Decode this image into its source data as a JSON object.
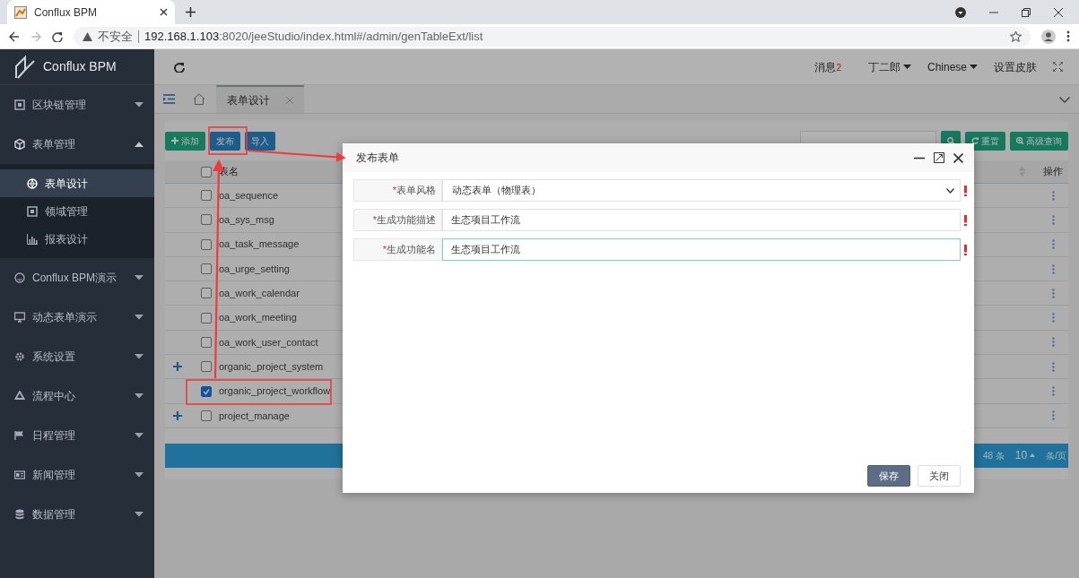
{
  "browser": {
    "tab_title": "Conflux BPM",
    "insecure_label": "不安全",
    "url_host": "192.168.1.103",
    "url_path": ":8020/jeeStudio/index.html#/admin/genTableExt/list"
  },
  "app": {
    "logo_text": "Conflux BPM"
  },
  "sidebar": {
    "items": [
      {
        "label": "区块链管理",
        "expanded": false
      },
      {
        "label": "表单管理",
        "expanded": true,
        "children": [
          {
            "label": "表单设计",
            "selected": true
          },
          {
            "label": "领域管理",
            "selected": false
          },
          {
            "label": "报表设计",
            "selected": false
          }
        ]
      },
      {
        "label": "Conflux BPM演示",
        "expanded": false
      },
      {
        "label": "动态表单演示",
        "expanded": false
      },
      {
        "label": "系统设置",
        "expanded": false
      },
      {
        "label": "流程中心",
        "expanded": false
      },
      {
        "label": "日程管理",
        "expanded": false
      },
      {
        "label": "新闻管理",
        "expanded": false
      },
      {
        "label": "数据管理",
        "expanded": false
      }
    ]
  },
  "header": {
    "messages_label": "消息",
    "messages_count": "2",
    "user": "丁二郎",
    "language": "Chinese",
    "skin": "设置皮肤"
  },
  "tabs": [
    {
      "label": "表单设计",
      "selected": true
    }
  ],
  "toolbar": {
    "buttons": [
      {
        "label": "添加",
        "kind": "add"
      },
      {
        "label": "发布",
        "kind": "publish"
      },
      {
        "label": "导入",
        "kind": "import"
      }
    ],
    "search_buttons": [
      {
        "kind": "search"
      },
      {
        "label": "重置",
        "kind": "reset"
      },
      {
        "label": "高级查询",
        "kind": "advanced"
      }
    ]
  },
  "table": {
    "columns": [
      "表名",
      "操作"
    ],
    "all_checked": false,
    "rows": [
      {
        "name": "oa_sequence",
        "checked": false,
        "expandable": false
      },
      {
        "name": "oa_sys_msg",
        "checked": false,
        "expandable": false
      },
      {
        "name": "oa_task_message",
        "checked": false,
        "expandable": false
      },
      {
        "name": "oa_urge_setting",
        "checked": false,
        "expandable": false
      },
      {
        "name": "oa_work_calendar",
        "checked": false,
        "expandable": false
      },
      {
        "name": "oa_work_meeting",
        "checked": false,
        "expandable": false
      },
      {
        "name": "oa_work_user_contact",
        "checked": false,
        "expandable": false
      },
      {
        "name": "organic_project_system",
        "checked": false,
        "expandable": true
      },
      {
        "name": "organic_project_workflow",
        "checked": true,
        "expandable": false
      },
      {
        "name": "project_manage",
        "checked": false,
        "expandable": true
      }
    ]
  },
  "pagination": {
    "total": "48 条",
    "page_size": "10",
    "unit": "条/页"
  },
  "dialog": {
    "title": "发布表单",
    "fields": [
      {
        "asterisk": "*",
        "label": "表单风格",
        "kind": "select",
        "value": "动态表单（物理表）",
        "required": true,
        "focused": false
      },
      {
        "asterisk": "*",
        "label": "生成功能描述",
        "kind": "text",
        "value": "生态项目工作流",
        "required": true,
        "focused": false
      },
      {
        "asterisk": "*",
        "label": "生成功能名",
        "kind": "text",
        "value": "生态项目工作流",
        "required": true,
        "focused": true
      }
    ],
    "buttons": [
      {
        "label": "保存",
        "kind": "primary"
      },
      {
        "label": "关闭",
        "kind": "default"
      }
    ]
  }
}
